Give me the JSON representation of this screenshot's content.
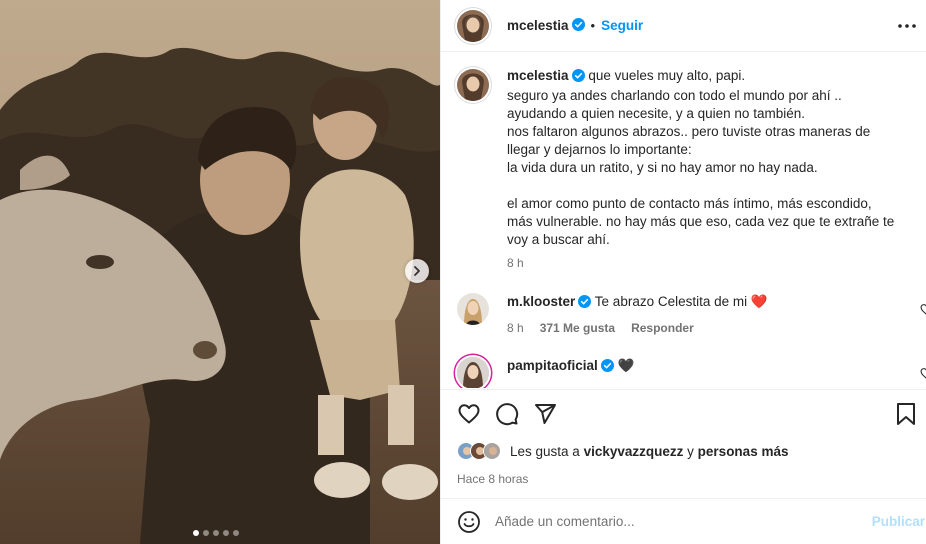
{
  "post": {
    "username": "mcelestia",
    "separator": "•",
    "follow_label": "Seguir",
    "more_icon": "more-horizontal-icon",
    "next_icon": "chevron-right-icon",
    "carousel": {
      "count": 5,
      "active_index": 1
    }
  },
  "caption": {
    "username": "mcelestia",
    "lines": [
      "que vueles muy alto, papi.",
      "seguro ya andes charlando con todo el mundo por ahí ..",
      "ayudando a quien necesite, y a quien no también.",
      "nos faltaron algunos abrazos.. pero tuviste otras maneras de",
      "llegar y dejarnos lo importante:",
      "la vida dura un ratito, y si no hay amor no hay nada.",
      "",
      "el amor como punto de contacto más íntimo, más escondido,",
      "más vulnerable. no hay más que eso, cada vez que te extrañe te",
      "voy a buscar ahí."
    ],
    "time": "8 h"
  },
  "comments": [
    {
      "username": "m.klooster",
      "text": "Te abrazo Celestita de mi",
      "emoji": "❤️",
      "time": "8 h",
      "likes": "371 Me gusta",
      "reply_label": "Responder"
    },
    {
      "username": "pampitaoficial",
      "text": "",
      "emoji": "🖤"
    }
  ],
  "actions": {
    "like_icon": "heart-icon",
    "comment_icon": "comment-icon",
    "share_icon": "send-icon",
    "save_icon": "bookmark-icon"
  },
  "likes": {
    "prefix": "Les gusta a",
    "user": "vickyvazzquezz",
    "connector": "y",
    "suffix": "personas más"
  },
  "time_ago": "Hace 8 horas",
  "add_comment": {
    "placeholder": "Añade un comentario...",
    "emoji_icon": "smiley-icon",
    "publish_label": "Publicar"
  },
  "colors": {
    "accent": "#0095f6",
    "verified": "#0095f6",
    "publish_disabled": "#b2dffc",
    "text": "#262626",
    "muted": "#737373",
    "heart_red": "#ed1c24"
  }
}
